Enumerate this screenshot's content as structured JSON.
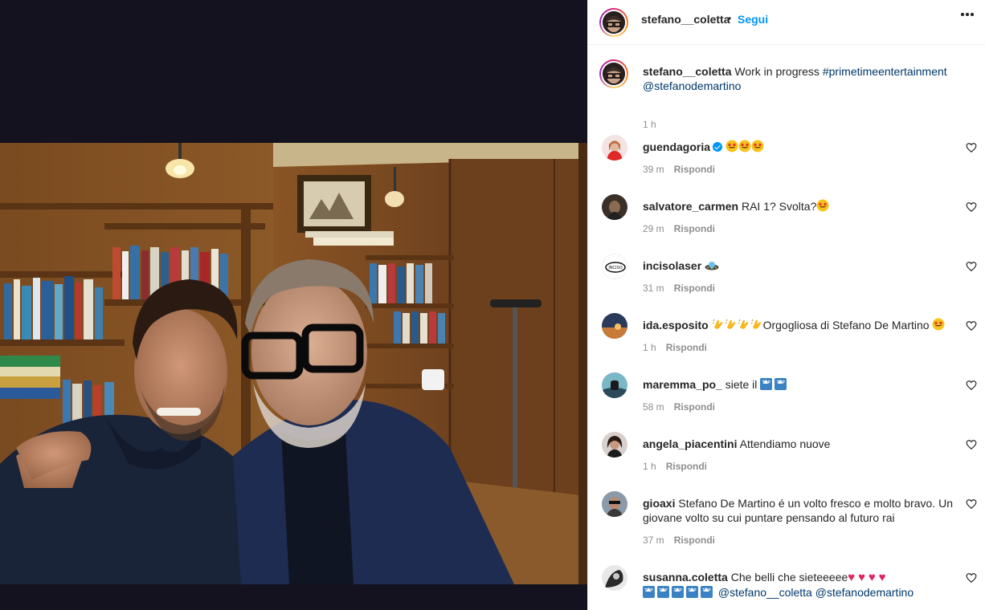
{
  "post": {
    "username": "stefano__coletta",
    "separator": "•",
    "follow_label": "Segui",
    "more_icon": "more-horizontal-icon"
  },
  "caption": {
    "username": "stefano__coletta",
    "text": " Work in progress ",
    "hashtag": "#primetimeentertainment",
    "mention": "@stefanodemartino",
    "time": "1 h"
  },
  "comments": [
    {
      "username": "guendagoria",
      "verified": true,
      "text": "",
      "emoji": [
        "star-struck",
        "star-struck",
        "star-struck"
      ],
      "time": "39 m",
      "reply": "Rispondi"
    },
    {
      "username": "salvatore_carmen",
      "text": "RAI 1? Svolta?",
      "emoji": [
        "star-struck"
      ],
      "time": "29 m",
      "reply": "Rispondi"
    },
    {
      "username": "incisolaser",
      "text": "",
      "emoji": [
        "flying-saucer"
      ],
      "time": "31 m",
      "reply": "Rispondi"
    },
    {
      "username": "ida.esposito",
      "text": "Orgogliosa di Stefano De Martino",
      "emoji": [
        "clapping-hands",
        "star-struck"
      ],
      "time": "1 h",
      "reply": "Rispondi"
    },
    {
      "username": "maremma_po_",
      "text": "siete il",
      "emoji": [
        "top-arrow",
        "top-arrow"
      ],
      "time": "58 m",
      "reply": "Rispondi"
    },
    {
      "username": "angela_piacentini",
      "text": "Attendiamo nuove",
      "time": "1 h",
      "reply": "Rispondi"
    },
    {
      "username": "gioaxi",
      "text": "Stefano De Martino é un volto fresco e molto bravo. Un giovane volto su cui puntare pensando al futuro rai",
      "time": "37 m",
      "reply": "Rispondi"
    },
    {
      "username": "susanna.coletta",
      "text": "Che belli che sieteeeee",
      "mentions": "@stefano__coletta @stefanodemartino",
      "emoji": [
        "red-heart",
        "top-arrow"
      ]
    }
  ],
  "colors": {
    "accent": "#0095f6",
    "text": "#262626",
    "secondary": "#8e8e8e",
    "link": "#00376b",
    "media_bg": "#13121e"
  }
}
